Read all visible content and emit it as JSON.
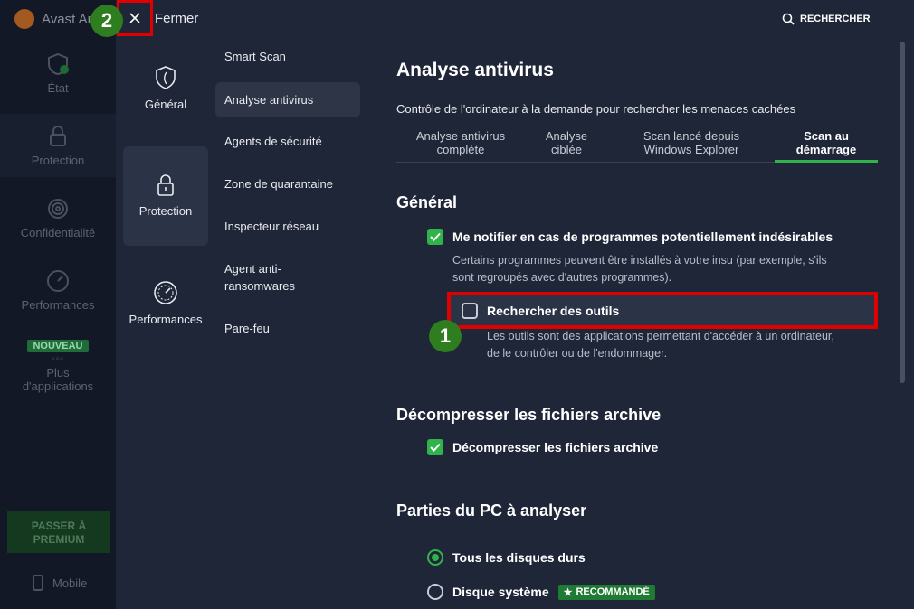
{
  "app": {
    "title": "Avast An"
  },
  "background_nav": [
    {
      "label": "État",
      "icon": "shield-check-icon"
    },
    {
      "label": "Protection",
      "icon": "lock-icon"
    },
    {
      "label": "Confidentialité",
      "icon": "fingerprint-icon"
    },
    {
      "label": "Performances",
      "icon": "gauge-icon"
    },
    {
      "label": "Plus d'applications",
      "icon": "apps-grid-icon",
      "badge": "NOUVEAU"
    }
  ],
  "premium_button": "PASSER À PREMIUM",
  "mobile_label": "Mobile",
  "topbar": {
    "close_label": "Fermer",
    "search_label": "RECHERCHER"
  },
  "step_badges": {
    "one": "1",
    "two": "2"
  },
  "categories": [
    {
      "label": "Général",
      "icon": "shield-icon"
    },
    {
      "label": "Protection",
      "icon": "lock-icon"
    },
    {
      "label": "Performances",
      "icon": "gauge-icon"
    }
  ],
  "submenu": [
    "Smart Scan",
    "Analyse antivirus",
    "Agents de sécurité",
    "Zone de quarantaine",
    "Inspecteur réseau",
    "Agent anti-ransomwares",
    "Pare-feu"
  ],
  "main": {
    "title": "Analyse antivirus",
    "description": "Contrôle de l'ordinateur à la demande pour rechercher les menaces cachées",
    "tabs": [
      {
        "line1": "Analyse antivirus",
        "line2": "complète"
      },
      {
        "line1": "Analyse",
        "line2": "ciblée"
      },
      {
        "line1": "Scan lancé depuis",
        "line2": "Windows Explorer"
      },
      {
        "line1": "Scan au",
        "line2": "démarrage"
      }
    ],
    "general": {
      "title": "Général",
      "pup_label": "Me notifier en cas de programmes potentiellement indésirables",
      "pup_checked": true,
      "pup_help_1": "Certains programmes peuvent être installés à votre insu (par exemple, s'ils",
      "pup_help_2": "sont regroupés avec d'autres programmes).",
      "tools_label": "Rechercher des outils",
      "tools_checked": false,
      "tools_help_1": "Les outils sont des applications permettant d'accéder à un ordinateur,",
      "tools_help_2": "de le contrôler ou de l'endommager."
    },
    "archives": {
      "title": "Décompresser les fichiers archive",
      "label": "Décompresser les fichiers archive",
      "checked": true
    },
    "pc_parts": {
      "title": "Parties du PC à analyser",
      "options": [
        {
          "label": "Tous les disques durs",
          "selected": true
        },
        {
          "label": "Disque système",
          "selected": false,
          "badge": "RECOMMANDÉ"
        }
      ]
    }
  },
  "colors": {
    "accent_green": "#2fb34a",
    "highlight_red": "#e00000",
    "panel": "#1f2638"
  }
}
